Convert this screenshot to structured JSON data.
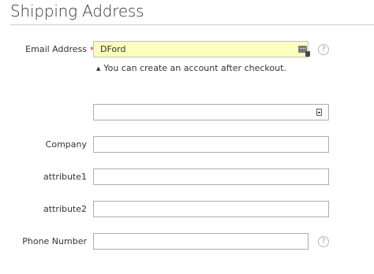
{
  "page": {
    "title": "Shipping Address"
  },
  "form": {
    "email": {
      "label": "Email Address",
      "required_mark": "*",
      "value": "DFord",
      "note": "You can create an account after checkout.",
      "help": "?"
    },
    "unlabeled_field": {
      "value": ""
    },
    "company": {
      "label": "Company",
      "value": ""
    },
    "attribute1": {
      "label": "attribute1",
      "value": ""
    },
    "attribute2": {
      "label": "attribute2",
      "value": ""
    },
    "phone": {
      "label": "Phone Number",
      "value": "",
      "help": "?"
    }
  },
  "icons": {
    "email_keyboard": "keyboard-icon",
    "autofill": "autofill-icon",
    "triangle": "triangle-up-icon"
  },
  "colors": {
    "autofill_background": "#faffbd",
    "required": "#e02b27",
    "border": "#adadad"
  }
}
